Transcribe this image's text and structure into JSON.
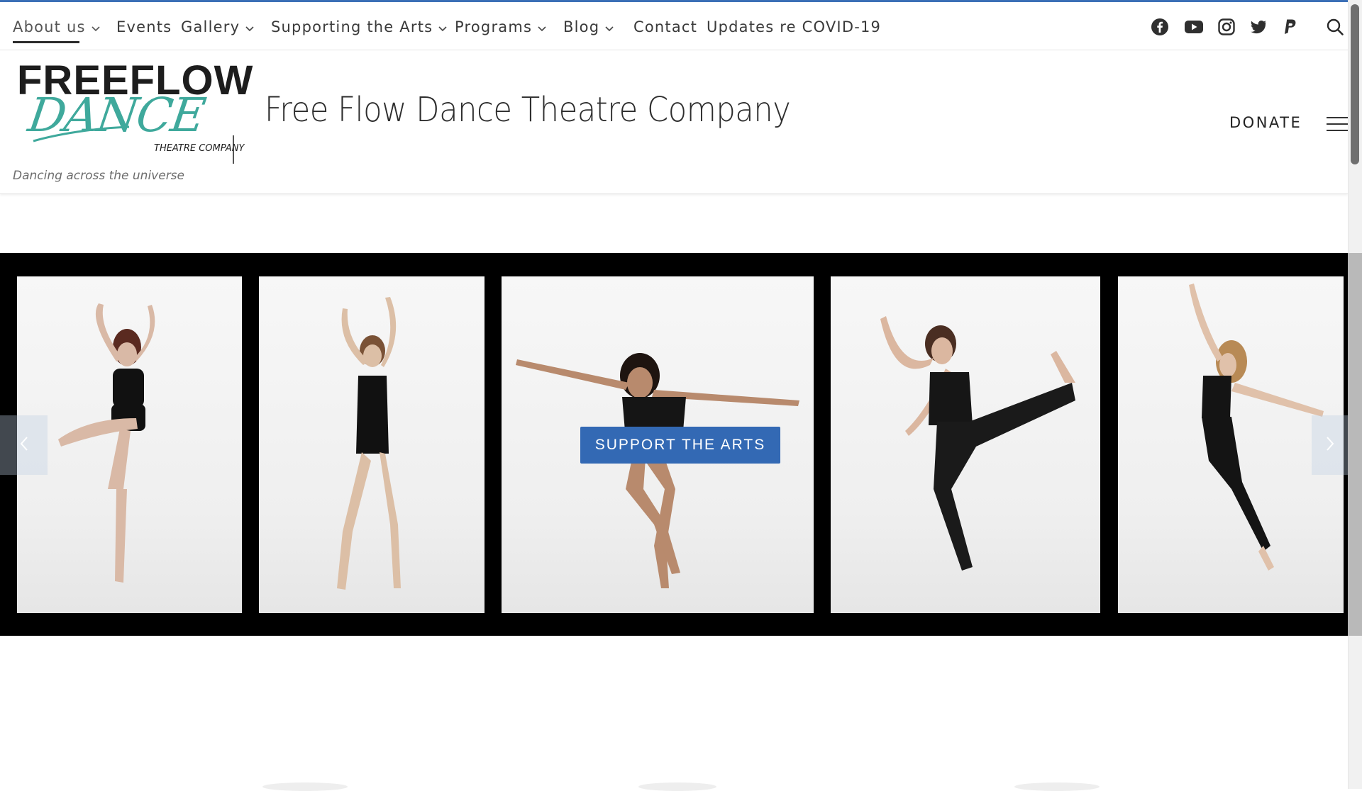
{
  "nav": {
    "items": [
      {
        "label": "About us",
        "dropdown": true,
        "active": true
      },
      {
        "label": "Events",
        "dropdown": false
      },
      {
        "label": "Gallery",
        "dropdown": true
      },
      {
        "label": "Supporting the Arts",
        "dropdown": true
      },
      {
        "label": "Programs",
        "dropdown": true
      },
      {
        "label": "Blog",
        "dropdown": true
      },
      {
        "label": "Contact",
        "dropdown": false
      },
      {
        "label": "Updates re COVID-19",
        "dropdown": false
      }
    ],
    "social_icons": [
      "facebook-icon",
      "youtube-icon",
      "instagram-icon",
      "twitter-icon",
      "paypal-icon"
    ],
    "search_icon": "search-icon"
  },
  "header": {
    "logo": {
      "line1": "FREEFLOW",
      "line2": "DANCE",
      "line3": "THEATRE COMPANY"
    },
    "site_title": "Free Flow Dance Theatre Company",
    "tagline": "Dancing across the universe",
    "donate_label": "DONATE",
    "menu_icon": "hamburger-icon"
  },
  "slider": {
    "cta_label": "SUPPORT THE ARTS",
    "photo_count": 5,
    "prev_icon": "chevron-left-icon",
    "next_icon": "chevron-right-icon"
  },
  "colors": {
    "accent_blue": "#3369b4",
    "top_bar": "#3b6fb6",
    "logo_teal": "#3fa99c",
    "logo_dark": "#1d1d1d"
  }
}
